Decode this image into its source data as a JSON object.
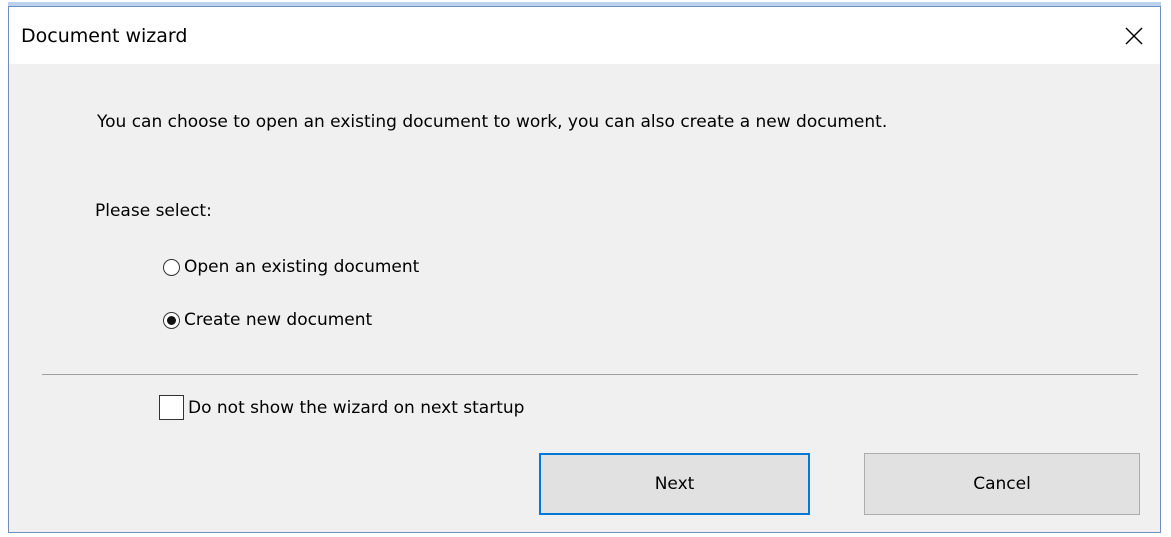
{
  "window": {
    "title": "Document wizard",
    "close_icon": "close-icon"
  },
  "content": {
    "description": "You can choose to open an existing document to work, you can also create a new document.",
    "prompt": "Please select:",
    "options": [
      {
        "label": "Open an existing document",
        "selected": false
      },
      {
        "label": "Create new document",
        "selected": true
      }
    ],
    "dont_show_label": "Do not show the wizard on next startup",
    "dont_show_checked": false
  },
  "buttons": {
    "next_label": "Next",
    "cancel_label": "Cancel"
  },
  "colors": {
    "dialog_bg": "#f0f0f0",
    "titlebar_bg": "#ffffff",
    "focus_border": "#0078d7",
    "button_bg": "#e1e1e1"
  }
}
